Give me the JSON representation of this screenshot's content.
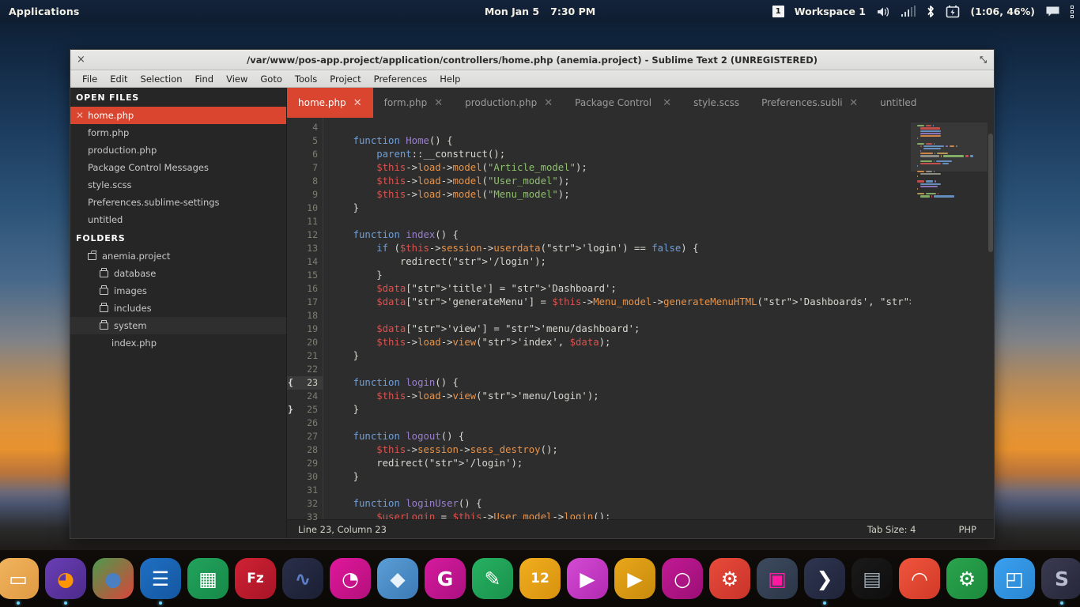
{
  "top_panel": {
    "applications_label": "Applications",
    "date": "Mon Jan  5",
    "time": "7:30 PM",
    "workspace_number": "1",
    "workspace_label": "Workspace 1",
    "battery": "(1:06, 46%)",
    "icons": [
      "volume-icon",
      "signal-icon",
      "bluetooth-icon",
      "battery-icon",
      "notification-icon",
      "menu-grid-icon"
    ]
  },
  "window": {
    "title": "/var/www/pos-app.project/application/controllers/home.php (anemia.project) - Sublime Text 2 (UNREGISTERED)",
    "close_label": "×",
    "maximize_label": "⤡",
    "menu": [
      "File",
      "Edit",
      "Selection",
      "Find",
      "View",
      "Goto",
      "Tools",
      "Project",
      "Preferences",
      "Help"
    ]
  },
  "sidebar": {
    "open_files_header": "OPEN FILES",
    "folders_header": "FOLDERS",
    "open_files": [
      {
        "label": "home.php",
        "active": true
      },
      {
        "label": "form.php",
        "active": false
      },
      {
        "label": "production.php",
        "active": false
      },
      {
        "label": "Package Control Messages",
        "active": false
      },
      {
        "label": "style.scss",
        "active": false
      },
      {
        "label": "Preferences.sublime-settings",
        "active": false
      },
      {
        "label": "untitled",
        "active": false
      }
    ],
    "project_root": "anemia.project",
    "folders": [
      {
        "label": "database",
        "highlighted": false
      },
      {
        "label": "images",
        "highlighted": false
      },
      {
        "label": "includes",
        "highlighted": false
      },
      {
        "label": "system",
        "highlighted": true
      }
    ],
    "files": [
      {
        "label": "index.php"
      }
    ]
  },
  "tabs": [
    {
      "label": "home.php",
      "active": true,
      "closable": true
    },
    {
      "label": "form.php",
      "active": false,
      "closable": true
    },
    {
      "label": "production.php",
      "active": false,
      "closable": true
    },
    {
      "label": "Package Control M",
      "active": false,
      "closable": true
    },
    {
      "label": "style.scss",
      "active": false,
      "closable": false
    },
    {
      "label": "Preferences.sublim",
      "active": false,
      "closable": true
    },
    {
      "label": "untitled",
      "active": false,
      "closable": false
    }
  ],
  "editor": {
    "first_line": 4,
    "current_line": 23,
    "brace_open_line": 23,
    "brace_close_line": 25,
    "lines": [
      {
        "n": 4,
        "text": ""
      },
      {
        "n": 5,
        "text": "    function Home() {"
      },
      {
        "n": 6,
        "text": "        parent::__construct();"
      },
      {
        "n": 7,
        "text": "        $this->load->model(\"Article_model\");"
      },
      {
        "n": 8,
        "text": "        $this->load->model(\"User_model\");"
      },
      {
        "n": 9,
        "text": "        $this->load->model(\"Menu_model\");"
      },
      {
        "n": 10,
        "text": "    }"
      },
      {
        "n": 11,
        "text": ""
      },
      {
        "n": 12,
        "text": "    function index() {"
      },
      {
        "n": 13,
        "text": "        if ($this->session->userdata('login') == false) {"
      },
      {
        "n": 14,
        "text": "            redirect('/login');"
      },
      {
        "n": 15,
        "text": "        }"
      },
      {
        "n": 16,
        "text": "        $data['title'] = 'Dashboard';"
      },
      {
        "n": 17,
        "text": "        $data['generateMenu'] = $this->Menu_model->generateMenuHTML('Dashboards', '', '');"
      },
      {
        "n": 18,
        "text": ""
      },
      {
        "n": 19,
        "text": "        $data['view'] = 'menu/dashboard';"
      },
      {
        "n": 20,
        "text": "        $this->load->view('index', $data);"
      },
      {
        "n": 21,
        "text": "    }"
      },
      {
        "n": 22,
        "text": ""
      },
      {
        "n": 23,
        "text": "    function login() {"
      },
      {
        "n": 24,
        "text": "        $this->load->view('menu/login');"
      },
      {
        "n": 25,
        "text": "    }"
      },
      {
        "n": 26,
        "text": ""
      },
      {
        "n": 27,
        "text": "    function logout() {"
      },
      {
        "n": 28,
        "text": "        $this->session->sess_destroy();"
      },
      {
        "n": 29,
        "text": "        redirect('/login');"
      },
      {
        "n": 30,
        "text": "    }"
      },
      {
        "n": 31,
        "text": ""
      },
      {
        "n": 32,
        "text": "    function loginUser() {"
      },
      {
        "n": 33,
        "text": "        $userLogin = $this->User_model->login();"
      }
    ]
  },
  "statusbar": {
    "cursor": "Line 23, Column 23",
    "tab_size": "Tab Size: 4",
    "syntax": "PHP"
  },
  "dock": {
    "items": [
      {
        "name": "files-icon",
        "glyph": "▭",
        "bg1": "#f0b45e",
        "bg2": "#e09a42",
        "fg": "#ffffff",
        "running": true
      },
      {
        "name": "firefox-icon",
        "glyph": "◕",
        "bg1": "#6a3fb5",
        "bg2": "#4c2a8a",
        "fg": "#ff9500",
        "running": true
      },
      {
        "name": "chrome-icon",
        "glyph": "●",
        "bg1": "#4d9a4d",
        "bg2": "#d9453a",
        "fg": "#4a7fc1",
        "running": false
      },
      {
        "name": "writer-icon",
        "glyph": "☰",
        "bg1": "#1f6fc4",
        "bg2": "#1457a0",
        "fg": "#ffffff",
        "running": true
      },
      {
        "name": "calc-icon",
        "glyph": "▦",
        "bg1": "#22a35c",
        "bg2": "#178a49",
        "fg": "#ffffff",
        "running": false
      },
      {
        "name": "filezilla-icon",
        "glyph": "Fz",
        "bg1": "#cf2233",
        "bg2": "#a71527",
        "fg": "#ffffff",
        "running": false
      },
      {
        "name": "dolphin-icon",
        "glyph": "∿",
        "bg1": "#2a2f4a",
        "bg2": "#1b1f33",
        "fg": "#5b7fc7",
        "running": false
      },
      {
        "name": "gimp-icon",
        "glyph": "◔",
        "bg1": "#e0179c",
        "bg2": "#b3107b",
        "fg": "#ffffff",
        "running": false
      },
      {
        "name": "inkscape-icon",
        "glyph": "◆",
        "bg1": "#5b9ed6",
        "bg2": "#3c7ab5",
        "fg": "#e8f2fb",
        "running": false
      },
      {
        "name": "glade-icon",
        "glyph": "G",
        "bg1": "#d61a9e",
        "bg2": "#ab1180",
        "fg": "#ffffff",
        "running": false
      },
      {
        "name": "notes-icon",
        "glyph": "✎",
        "bg1": "#27b162",
        "bg2": "#1a914c",
        "fg": "#ffffff",
        "running": false
      },
      {
        "name": "calendar-icon",
        "glyph": "12",
        "bg1": "#f0ae1e",
        "bg2": "#d8920f",
        "fg": "#ffffff",
        "running": false
      },
      {
        "name": "mediaplayer-icon",
        "glyph": "▶",
        "bg1": "#d44ad4",
        "bg2": "#b12ab1",
        "fg": "#ffffff",
        "running": false
      },
      {
        "name": "videoplayer-icon",
        "glyph": "▶",
        "bg1": "#e8a71a",
        "bg2": "#c88a0d",
        "fg": "#ffffff",
        "running": false
      },
      {
        "name": "search-icon",
        "glyph": "○",
        "bg1": "#c01a93",
        "bg2": "#9c0f76",
        "fg": "#ffffff",
        "running": false
      },
      {
        "name": "settings-icon",
        "glyph": "⚙",
        "bg1": "#e84b3a",
        "bg2": "#c8332a",
        "fg": "#ffffff",
        "running": false
      },
      {
        "name": "screenshot-icon",
        "glyph": "▣",
        "bg1": "#3d4a5e",
        "bg2": "#2b3648",
        "fg": "#ff1aa0",
        "running": false
      },
      {
        "name": "terminal-icon",
        "glyph": "❯",
        "bg1": "#2e3550",
        "bg2": "#1f2439",
        "fg": "#ffffff",
        "running": true
      },
      {
        "name": "save-icon",
        "glyph": "▤",
        "bg1": "#1a1a1a",
        "bg2": "#0e0e0e",
        "fg": "#9aa6b2",
        "running": false
      },
      {
        "name": "wifi-icon",
        "glyph": "◠",
        "bg1": "#f0553d",
        "bg2": "#d13a28",
        "fg": "#ffffff",
        "running": false
      },
      {
        "name": "toggles-icon",
        "glyph": "⚙",
        "bg1": "#2aa44e",
        "bg2": "#1c8a3c",
        "fg": "#ffffff",
        "running": false
      },
      {
        "name": "windows-icon",
        "glyph": "◰",
        "bg1": "#3aa0ef",
        "bg2": "#2a86d0",
        "fg": "#ffffff",
        "running": false
      },
      {
        "name": "sublime-icon",
        "glyph": "S",
        "bg1": "#3a3a52",
        "bg2": "#27273a",
        "fg": "#b8bed0",
        "running": true
      }
    ]
  }
}
